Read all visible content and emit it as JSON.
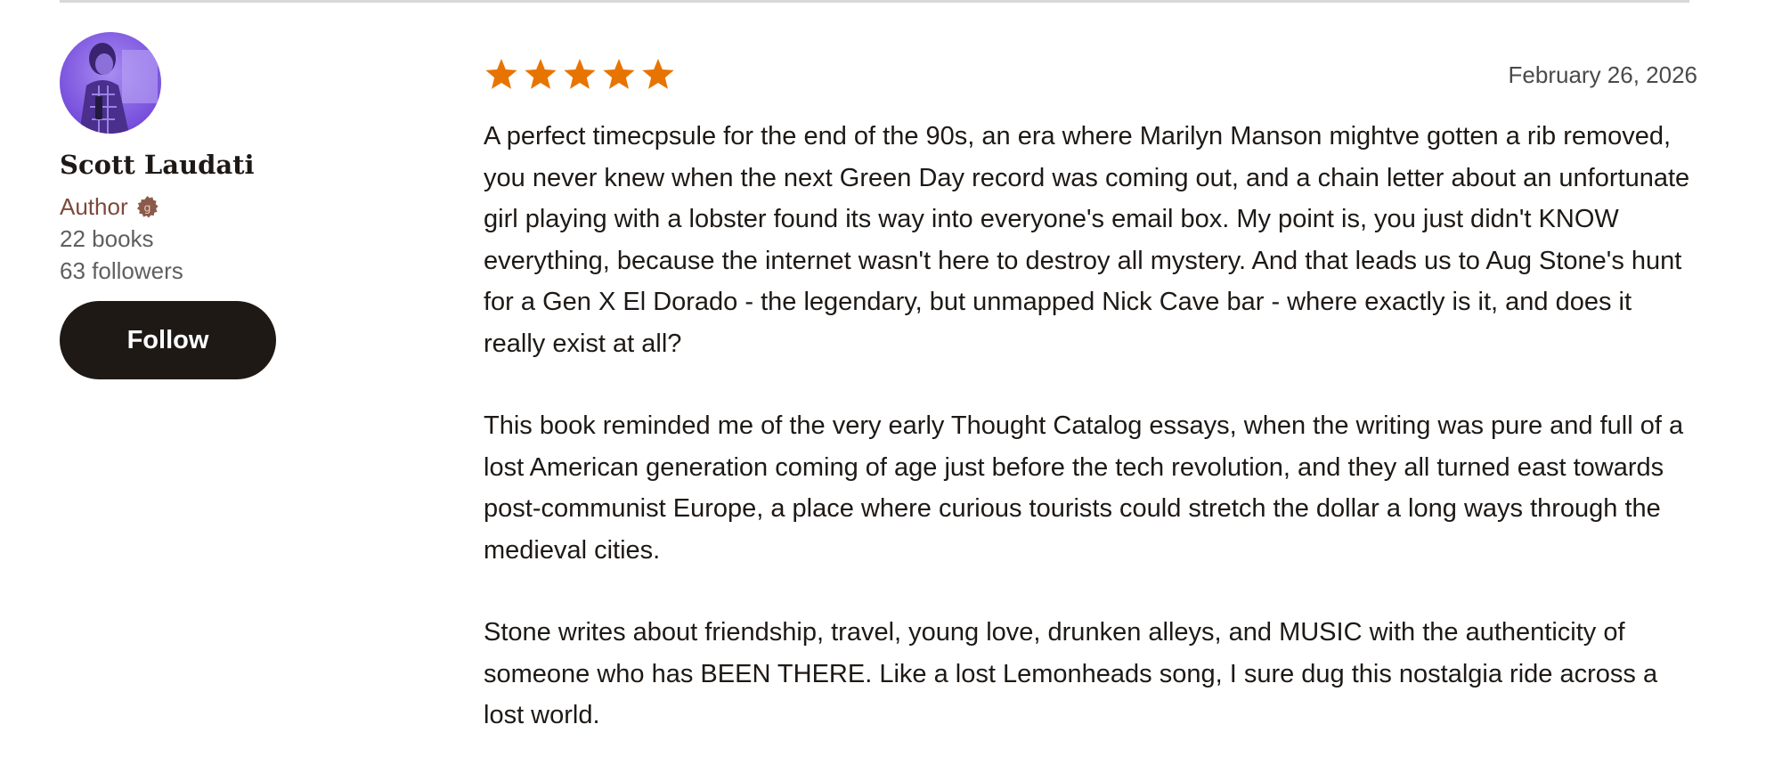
{
  "reviewer": {
    "avatar_alt": "Scott Laudati",
    "name": "Scott Laudati",
    "role": "Author",
    "books": "22 books",
    "followers": "63 followers",
    "follow_label": "Follow"
  },
  "review": {
    "rating": 5,
    "rating_max": 5,
    "date": "February 26, 2026",
    "paragraphs": [
      "A perfect timecpsule for the end of the 90s, an era where Marilyn Manson mightve gotten a rib removed, you never knew when the next Green Day record was coming out, and a chain letter about an unfortunate girl playing with a lobster found its way into everyone's email box. My point is, you just didn't KNOW everything, because the internet wasn't here to destroy all mystery. And that leads us to Aug Stone's hunt for a Gen X El Dorado - the legendary, but unmapped Nick Cave bar - where exactly is it, and does it really exist at all?",
      "This book reminded me of the very early Thought Catalog essays, when the writing was pure and full of a lost American generation coming of age just before the tech revolution, and they all turned east towards post-communist Europe, a place where curious tourists could stretch the dollar a long ways through the medieval cities.",
      "Stone writes about friendship, travel, young love, drunken alleys, and MUSIC with the authenticity of someone who has BEEN THERE. Like a lost Lemonheads song, I sure dug this nostalgia ride across a lost world."
    ]
  },
  "colors": {
    "star": "#e87400",
    "follow_bg": "#1e1915",
    "author_role": "#7c4a3a",
    "badge": "#8a5a4a",
    "avatar_tint": "#7a4ee0"
  },
  "icons": {
    "star": "star-icon",
    "author_badge": "author-badge-icon"
  }
}
